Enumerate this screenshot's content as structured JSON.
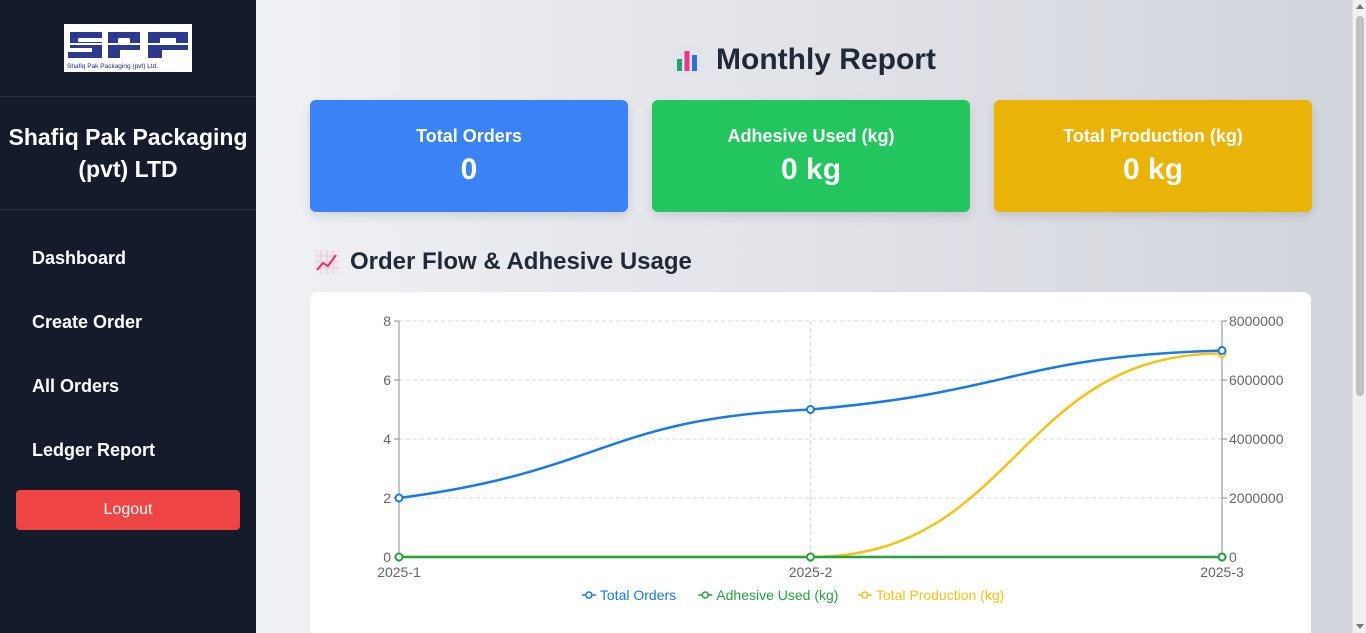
{
  "sidebar": {
    "logo_caption": "Shafiq Pak Packaging (pvt) Ltd.",
    "company_name": "Shafiq Pak Packaging (pvt) LTD",
    "nav": [
      "Dashboard",
      "Create Order",
      "All Orders",
      "Ledger Report"
    ],
    "logout_label": "Logout"
  },
  "header": {
    "title": "Monthly Report"
  },
  "cards": [
    {
      "label": "Total Orders",
      "value": "0",
      "color": "#3b82f6"
    },
    {
      "label": "Adhesive Used (kg)",
      "value": "0 kg",
      "color": "#22c55e"
    },
    {
      "label": "Total Production (kg)",
      "value": "0 kg",
      "color": "#eab308"
    }
  ],
  "section": {
    "title": "Order Flow & Adhesive Usage"
  },
  "chart_data": {
    "type": "line",
    "categories": [
      "2025-1",
      "2025-2",
      "2025-3"
    ],
    "y_left": {
      "min": 0,
      "max": 8,
      "ticks": [
        0,
        2,
        4,
        6,
        8
      ]
    },
    "y_right": {
      "min": 0,
      "max": 8000000,
      "ticks": [
        0,
        2000000,
        4000000,
        6000000,
        8000000
      ],
      "tick_labels": [
        "0",
        "2000000",
        "4000000",
        "6000000",
        "8000000"
      ]
    },
    "grid": true,
    "legend": "bottom",
    "series": [
      {
        "name": "Total Orders",
        "axis": "left",
        "color": "#1a7ae8",
        "values": [
          2,
          5,
          7
        ]
      },
      {
        "name": "Adhesive Used (kg)",
        "axis": "left",
        "color": "#27a043",
        "values": [
          0,
          0,
          0
        ]
      },
      {
        "name": "Total Production (kg)",
        "axis": "right",
        "color": "#f2c218",
        "values": [
          0,
          0,
          6900000
        ]
      }
    ]
  }
}
